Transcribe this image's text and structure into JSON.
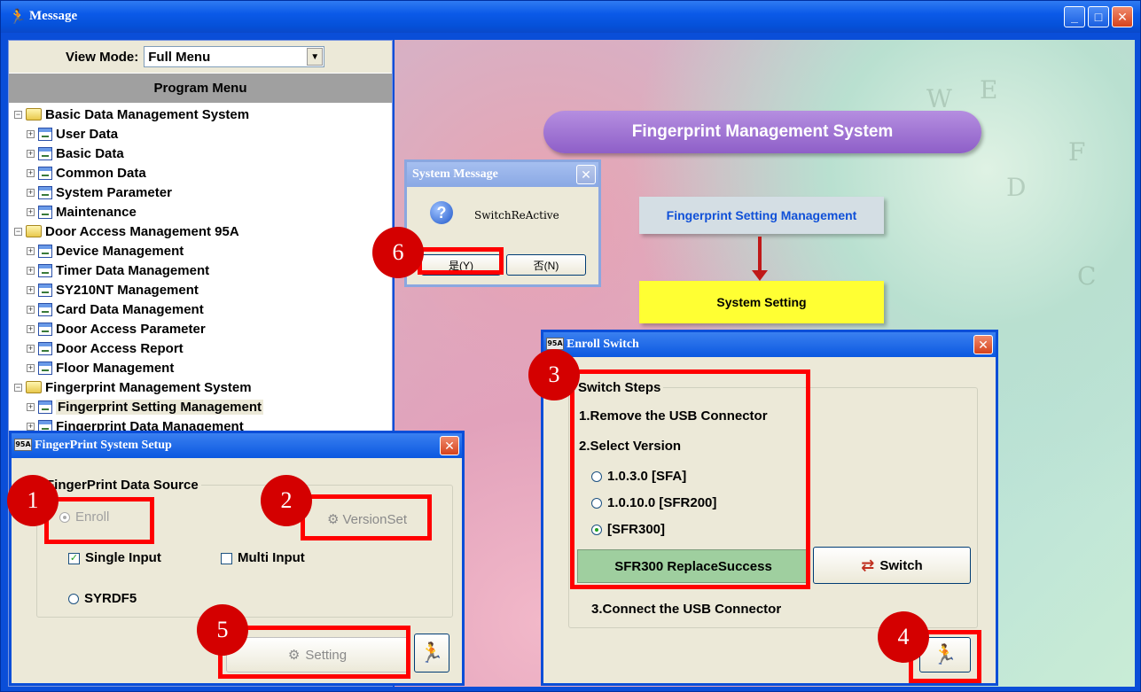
{
  "window": {
    "title": "Message"
  },
  "left_panel": {
    "view_mode_label": "View Mode:",
    "view_mode_value": "Full Menu",
    "program_menu_label": "Program Menu",
    "tree": [
      {
        "label": "Basic Data Management System",
        "level": 0,
        "icon": "folder-icon",
        "expander": "−"
      },
      {
        "label": "User Data",
        "level": 1,
        "icon": "page-icon",
        "expander": "+"
      },
      {
        "label": "Basic Data",
        "level": 1,
        "icon": "page-icon",
        "expander": "+"
      },
      {
        "label": "Common Data",
        "level": 1,
        "icon": "page-icon",
        "expander": "+"
      },
      {
        "label": "System Parameter",
        "level": 1,
        "icon": "page-icon",
        "expander": "+"
      },
      {
        "label": "Maintenance",
        "level": 1,
        "icon": "page-icon",
        "expander": "+"
      },
      {
        "label": "Door Access Management 95A",
        "level": 0,
        "icon": "folder-icon",
        "expander": "−"
      },
      {
        "label": "Device Management",
        "level": 1,
        "icon": "page-icon",
        "expander": "+"
      },
      {
        "label": "Timer Data Management",
        "level": 1,
        "icon": "page-icon",
        "expander": "+"
      },
      {
        "label": "SY210NT Management",
        "level": 1,
        "icon": "page-icon",
        "expander": "+"
      },
      {
        "label": "Card Data Management",
        "level": 1,
        "icon": "page-icon",
        "expander": "+"
      },
      {
        "label": "Door Access Parameter",
        "level": 1,
        "icon": "page-icon",
        "expander": "+"
      },
      {
        "label": "Door Access Report",
        "level": 1,
        "icon": "page-icon",
        "expander": "+"
      },
      {
        "label": "Floor Management",
        "level": 1,
        "icon": "page-icon",
        "expander": "+"
      },
      {
        "label": "Fingerprint Management System",
        "level": 0,
        "icon": "folder-icon",
        "expander": "−"
      },
      {
        "label": "Fingerprint Setting Management",
        "level": 1,
        "icon": "page-icon",
        "expander": "+",
        "selected": true
      },
      {
        "label": "Fingerprint Data Management",
        "level": 1,
        "icon": "page-icon",
        "expander": "+"
      }
    ]
  },
  "flow": {
    "title": "Fingerprint Management System",
    "step1": "Fingerprint Setting Management",
    "step2": "System Setting"
  },
  "system_message": {
    "title": "System Message",
    "message": "SwitchReActive",
    "yes_label": "是(Y)",
    "no_label": "否(N)"
  },
  "fingerprint_setup": {
    "title": "FingerPrint System Setup",
    "group_label": "FingerPrint Data Source",
    "enroll_label": "Enroll",
    "versionset_label": "VersionSet",
    "single_input_label": "Single Input",
    "single_input_checked": true,
    "multi_input_label": "Multi Input",
    "multi_input_checked": false,
    "syrdf5_label": "SYRDF5",
    "setting_label": "Setting"
  },
  "enroll_switch": {
    "title": "Enroll Switch",
    "group_label": "Switch Steps",
    "step1": "1.Remove the USB Connector",
    "step2": "2.Select Version",
    "options": [
      {
        "label": "1.0.3.0  [SFA]",
        "selected": false
      },
      {
        "label": "1.0.10.0  [SFR200]",
        "selected": false
      },
      {
        "label": "[SFR300]",
        "selected": true
      }
    ],
    "status": "SFR300 ReplaceSuccess",
    "switch_label": "Switch",
    "step3": "3.Connect the USB Connector"
  },
  "markers": [
    "1",
    "2",
    "3",
    "4",
    "5",
    "6"
  ],
  "colors": {
    "accent_red": "#ff0000",
    "marker_red": "#d40000",
    "xp_blue": "#0a4ed8",
    "status_green": "#9fcf9f",
    "flow_yellow": "#ffff33"
  }
}
